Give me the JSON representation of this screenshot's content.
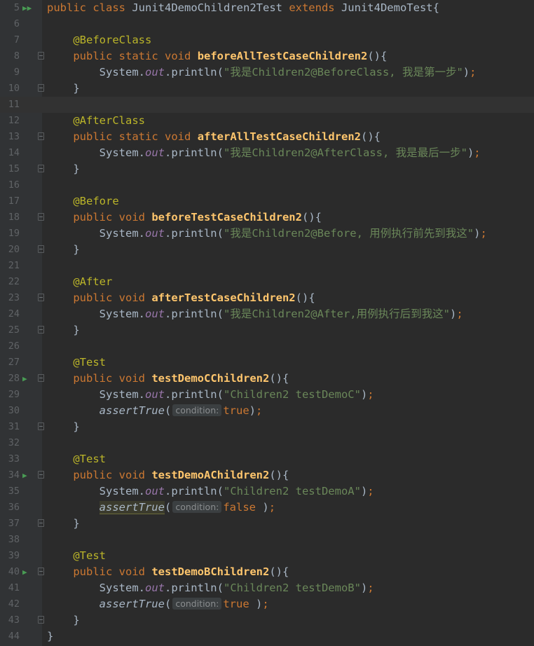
{
  "lines": [
    {
      "n": "5",
      "run": "double",
      "tokens": [
        [
          "kw",
          "public"
        ],
        [
          "p",
          " "
        ],
        [
          "kw",
          "class"
        ],
        [
          "p",
          " Junit4DemoChildren2Test "
        ],
        [
          "kw",
          "extends"
        ],
        [
          "p",
          " Junit4DemoTest{"
        ]
      ]
    },
    {
      "n": "6",
      "tokens": []
    },
    {
      "n": "7",
      "tokens": [
        [
          "p",
          "    "
        ],
        [
          "ann",
          "@BeforeClass"
        ]
      ]
    },
    {
      "n": "8",
      "fold": true,
      "tokens": [
        [
          "p",
          "    "
        ],
        [
          "kw",
          "public"
        ],
        [
          "p",
          " "
        ],
        [
          "kw",
          "static"
        ],
        [
          "p",
          " "
        ],
        [
          "kw",
          "void"
        ],
        [
          "p",
          " "
        ],
        [
          "fn",
          "beforeAllTestCaseChildren2"
        ],
        [
          "p",
          "(){"
        ]
      ]
    },
    {
      "n": "9",
      "tokens": [
        [
          "p",
          "        System."
        ],
        [
          "fld",
          "out"
        ],
        [
          "p",
          ".println("
        ],
        [
          "str",
          "\"我是Children2@BeforeClass, 我是第一步\""
        ],
        [
          "p",
          ")"
        ],
        [
          "kw",
          ";"
        ]
      ]
    },
    {
      "n": "10",
      "fold": true,
      "tokens": [
        [
          "p",
          "    }"
        ]
      ]
    },
    {
      "n": "11",
      "current": true,
      "tokens": []
    },
    {
      "n": "12",
      "tokens": [
        [
          "p",
          "    "
        ],
        [
          "ann",
          "@AfterClass"
        ]
      ]
    },
    {
      "n": "13",
      "fold": true,
      "tokens": [
        [
          "p",
          "    "
        ],
        [
          "kw",
          "public"
        ],
        [
          "p",
          " "
        ],
        [
          "kw",
          "static"
        ],
        [
          "p",
          " "
        ],
        [
          "kw",
          "void"
        ],
        [
          "p",
          " "
        ],
        [
          "fn",
          "afterAllTestCaseChildren2"
        ],
        [
          "p",
          "(){"
        ]
      ]
    },
    {
      "n": "14",
      "tokens": [
        [
          "p",
          "        System."
        ],
        [
          "fld",
          "out"
        ],
        [
          "p",
          ".println("
        ],
        [
          "str",
          "\"我是Children2@AfterClass, 我是最后一步\""
        ],
        [
          "p",
          ")"
        ],
        [
          "kw",
          ";"
        ]
      ]
    },
    {
      "n": "15",
      "fold": true,
      "tokens": [
        [
          "p",
          "    }"
        ]
      ]
    },
    {
      "n": "16",
      "tokens": []
    },
    {
      "n": "17",
      "tokens": [
        [
          "p",
          "    "
        ],
        [
          "ann",
          "@Before"
        ]
      ]
    },
    {
      "n": "18",
      "fold": true,
      "tokens": [
        [
          "p",
          "    "
        ],
        [
          "kw",
          "public"
        ],
        [
          "p",
          " "
        ],
        [
          "kw",
          "void"
        ],
        [
          "p",
          " "
        ],
        [
          "fn",
          "beforeTestCaseChildren2"
        ],
        [
          "p",
          "(){"
        ]
      ]
    },
    {
      "n": "19",
      "tokens": [
        [
          "p",
          "        System."
        ],
        [
          "fld",
          "out"
        ],
        [
          "p",
          ".println("
        ],
        [
          "str",
          "\"我是Children2@Before, 用例执行前先到我这\""
        ],
        [
          "p",
          ")"
        ],
        [
          "kw",
          ";"
        ]
      ]
    },
    {
      "n": "20",
      "fold": true,
      "tokens": [
        [
          "p",
          "    }"
        ]
      ]
    },
    {
      "n": "21",
      "tokens": []
    },
    {
      "n": "22",
      "tokens": [
        [
          "p",
          "    "
        ],
        [
          "ann",
          "@After"
        ]
      ]
    },
    {
      "n": "23",
      "fold": true,
      "tokens": [
        [
          "p",
          "    "
        ],
        [
          "kw",
          "public"
        ],
        [
          "p",
          " "
        ],
        [
          "kw",
          "void"
        ],
        [
          "p",
          " "
        ],
        [
          "fn",
          "afterTestCaseChildren2"
        ],
        [
          "p",
          "(){"
        ]
      ]
    },
    {
      "n": "24",
      "tokens": [
        [
          "p",
          "        System."
        ],
        [
          "fld",
          "out"
        ],
        [
          "p",
          ".println("
        ],
        [
          "str",
          "\"我是Children2@After,用例执行后到我这\""
        ],
        [
          "p",
          ")"
        ],
        [
          "kw",
          ";"
        ]
      ]
    },
    {
      "n": "25",
      "fold": true,
      "tokens": [
        [
          "p",
          "    }"
        ]
      ]
    },
    {
      "n": "26",
      "tokens": []
    },
    {
      "n": "27",
      "tokens": [
        [
          "p",
          "    "
        ],
        [
          "ann",
          "@Test"
        ]
      ]
    },
    {
      "n": "28",
      "run": "single",
      "fold": true,
      "tokens": [
        [
          "p",
          "    "
        ],
        [
          "kw",
          "public"
        ],
        [
          "p",
          " "
        ],
        [
          "kw",
          "void"
        ],
        [
          "p",
          " "
        ],
        [
          "fn",
          "testDemoCChildren2"
        ],
        [
          "p",
          "(){"
        ]
      ]
    },
    {
      "n": "29",
      "tokens": [
        [
          "p",
          "        System."
        ],
        [
          "fld",
          "out"
        ],
        [
          "p",
          ".println("
        ],
        [
          "str",
          "\"Children2 testDemoC\""
        ],
        [
          "p",
          ")"
        ],
        [
          "kw",
          ";"
        ]
      ]
    },
    {
      "n": "30",
      "tokens": [
        [
          "p",
          "        "
        ],
        [
          "static",
          "assertTrue"
        ],
        [
          "p",
          "("
        ],
        [
          "hint",
          "condition:"
        ],
        [
          "kw",
          "true"
        ],
        [
          "p",
          ")"
        ],
        [
          "kw",
          ";"
        ]
      ]
    },
    {
      "n": "31",
      "fold": true,
      "tokens": [
        [
          "p",
          "    }"
        ]
      ]
    },
    {
      "n": "32",
      "tokens": []
    },
    {
      "n": "33",
      "tokens": [
        [
          "p",
          "    "
        ],
        [
          "ann",
          "@Test"
        ]
      ]
    },
    {
      "n": "34",
      "run": "single",
      "fold": true,
      "tokens": [
        [
          "p",
          "    "
        ],
        [
          "kw",
          "public"
        ],
        [
          "p",
          " "
        ],
        [
          "kw",
          "void"
        ],
        [
          "p",
          " "
        ],
        [
          "fn",
          "testDemoAChildren2"
        ],
        [
          "p",
          "(){"
        ]
      ]
    },
    {
      "n": "35",
      "tokens": [
        [
          "p",
          "        System."
        ],
        [
          "fld",
          "out"
        ],
        [
          "p",
          ".println("
        ],
        [
          "str",
          "\"Children2 testDemoA\""
        ],
        [
          "p",
          ")"
        ],
        [
          "kw",
          ";"
        ]
      ]
    },
    {
      "n": "36",
      "tokens": [
        [
          "p",
          "        "
        ],
        [
          "statichl",
          "assertTrue"
        ],
        [
          "p",
          "("
        ],
        [
          "hint",
          "condition:"
        ],
        [
          "kw",
          "false"
        ],
        [
          "p",
          " )"
        ],
        [
          "kw",
          ";"
        ]
      ]
    },
    {
      "n": "37",
      "fold": true,
      "tokens": [
        [
          "p",
          "    }"
        ]
      ]
    },
    {
      "n": "38",
      "tokens": []
    },
    {
      "n": "39",
      "tokens": [
        [
          "p",
          "    "
        ],
        [
          "ann",
          "@Test"
        ]
      ]
    },
    {
      "n": "40",
      "run": "single",
      "fold": true,
      "tokens": [
        [
          "p",
          "    "
        ],
        [
          "kw",
          "public"
        ],
        [
          "p",
          " "
        ],
        [
          "kw",
          "void"
        ],
        [
          "p",
          " "
        ],
        [
          "fn",
          "testDemoBChildren2"
        ],
        [
          "p",
          "(){"
        ]
      ]
    },
    {
      "n": "41",
      "tokens": [
        [
          "p",
          "        System."
        ],
        [
          "fld",
          "out"
        ],
        [
          "p",
          ".println("
        ],
        [
          "str",
          "\"Children2 testDemoB\""
        ],
        [
          "p",
          ")"
        ],
        [
          "kw",
          ";"
        ]
      ]
    },
    {
      "n": "42",
      "tokens": [
        [
          "p",
          "        "
        ],
        [
          "static",
          "assertTrue"
        ],
        [
          "p",
          "("
        ],
        [
          "hint",
          "condition:"
        ],
        [
          "kw",
          "true"
        ],
        [
          "p",
          " )"
        ],
        [
          "kw",
          ";"
        ]
      ]
    },
    {
      "n": "43",
      "fold": true,
      "tokens": [
        [
          "p",
          "    }"
        ]
      ]
    },
    {
      "n": "44",
      "tokens": [
        [
          "p",
          "}"
        ]
      ]
    }
  ],
  "icons": {
    "run_double": "▶▶",
    "run_single": "▶"
  }
}
